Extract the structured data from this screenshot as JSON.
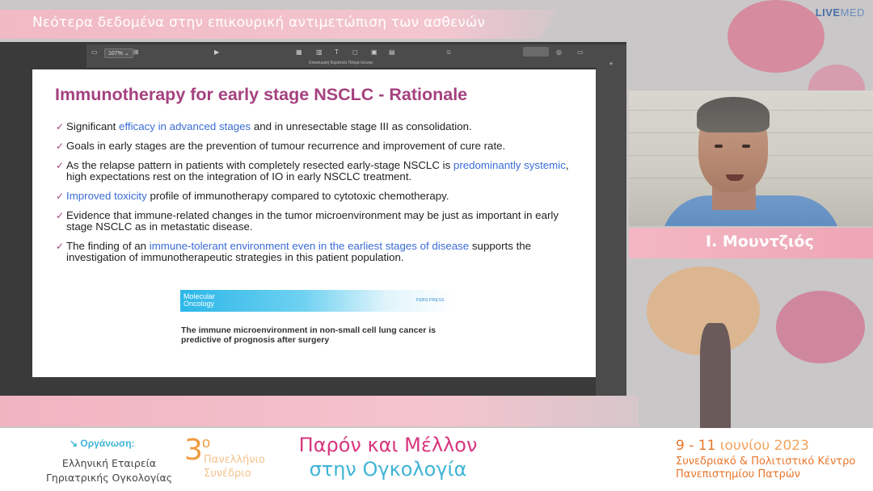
{
  "header": {
    "title": "Νεότερα δεδομένα στην επικουρική αντιμετώπιση των ασθενών",
    "brand_part1": "LIVE",
    "brand_part2": "MED"
  },
  "presenter_toolbar": {
    "zoom": "107% ⌄",
    "document_title": "Επικουρική θεραπεία Πάτρα Ιούνιος"
  },
  "slide": {
    "title": "Immunotherapy for early stage NSCLC - Rationale",
    "bullets": [
      {
        "pre": "Significant ",
        "hl": "efficacy in advanced stages",
        "post": " and in unresectable stage III as consolidation."
      },
      {
        "pre": "Goals in early stages are the prevention of tumour recurrence and improvement of cure rate.",
        "hl": "",
        "post": ""
      },
      {
        "pre": "As the relapse pattern in patients with completely resected early-stage NSCLC is ",
        "hl": "predominantly systemic",
        "post": ", high expectations rest on the integration of IO in early NSCLC treatment."
      },
      {
        "pre": "",
        "hl": "Improved toxicity",
        "post": " profile of immunotherapy compared to cytotoxic chemotherapy."
      },
      {
        "pre": "Evidence that immune-related changes in the tumor microenvironment may be just as important in early stage NSCLC as in metastatic disease.",
        "hl": "",
        "post": ""
      },
      {
        "pre": "The finding of an ",
        "hl": "immune-tolerant environment even in the earliest stages of disease",
        "post": " supports the investigation of immunotherapeutic strategies in this patient population."
      }
    ],
    "journal": "Molecular Oncology",
    "publisher": "FEBS PRESS",
    "paper_title": "The immune microenvironment in non-small cell lung cancer is predictive of prognosis after surgery"
  },
  "speaker": {
    "name": "Ι. Μουντζιός"
  },
  "footer": {
    "org_label": "Οργάνωση:",
    "org_name": "Ελληνική Εταιρεία Γηριατρικής Ογκολογίας",
    "conf_number": "3",
    "conf_sup": "ο",
    "conf_type_line1": "Πανελλήνιο",
    "conf_type_line2": "Συνέδριο",
    "conf_title_line1": "Παρόν και Μέλλον",
    "conf_title_line2": "στην Ογκολογία",
    "date_days": "9 - 11",
    "date_month_year": " ιουνίου 2023",
    "venue_line1": "Συνεδριακό & Πολιτιστικό Κέντρο",
    "venue_line2": "Πανεπιστημίου Πατρών"
  },
  "colors": {
    "slide_title": "#a5417f",
    "highlight": "#3a6cd6",
    "pink_band": "#f3c6cf",
    "conf_title_pink": "#d8367e",
    "conf_title_blue": "#3fb4d6",
    "orange": "#e8762b"
  }
}
